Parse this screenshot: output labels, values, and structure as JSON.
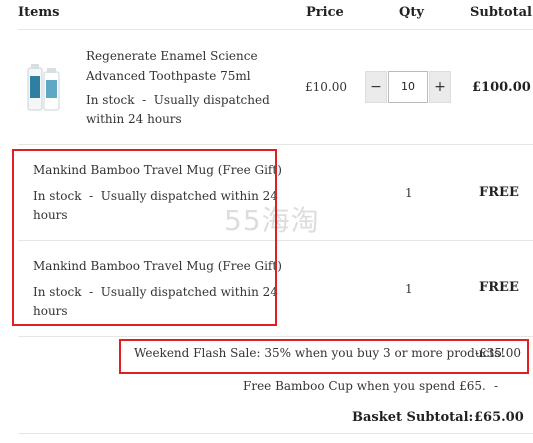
{
  "header": {
    "items": "Items",
    "price": "Price",
    "qty": "Qty",
    "subtotal": "Subtotal"
  },
  "rows": [
    {
      "name_line1": "Regenerate Enamel Science",
      "name_line2": "Advanced Toothpaste 75ml",
      "stock_line1": "In stock  -  Usually dispatched",
      "stock_line2": "within 24 hours",
      "price": "£10.00",
      "qty": "10",
      "subtotal": "£100.00"
    },
    {
      "name": "Mankind Bamboo Travel Mug (Free Gift)",
      "stock_line1": "In stock  -  Usually dispatched within 24",
      "stock_line2": "hours",
      "qty": "1",
      "subtotal": "FREE"
    },
    {
      "name": "Mankind Bamboo Travel Mug (Free Gift)",
      "stock_line1": "In stock  -  Usually dispatched within 24",
      "stock_line2": "hours",
      "qty": "1",
      "subtotal": "FREE"
    }
  ],
  "qty_controls": {
    "minus": "−",
    "plus": "+"
  },
  "summary": {
    "promo_label": "Weekend Flash Sale: 35% when you buy 3 or more products!",
    "promo_value": "-£35.00",
    "cup_label": "Free Bamboo Cup when you spend £65.",
    "cup_value": "-",
    "basket_label": "Basket Subtotal:",
    "basket_value": "£65.00"
  },
  "watermark": "55海淘",
  "colors": {
    "highlight": "#e02020",
    "divider": "#e6e6e6"
  },
  "product_image": {
    "icon": "toothpaste-tube-icon"
  }
}
